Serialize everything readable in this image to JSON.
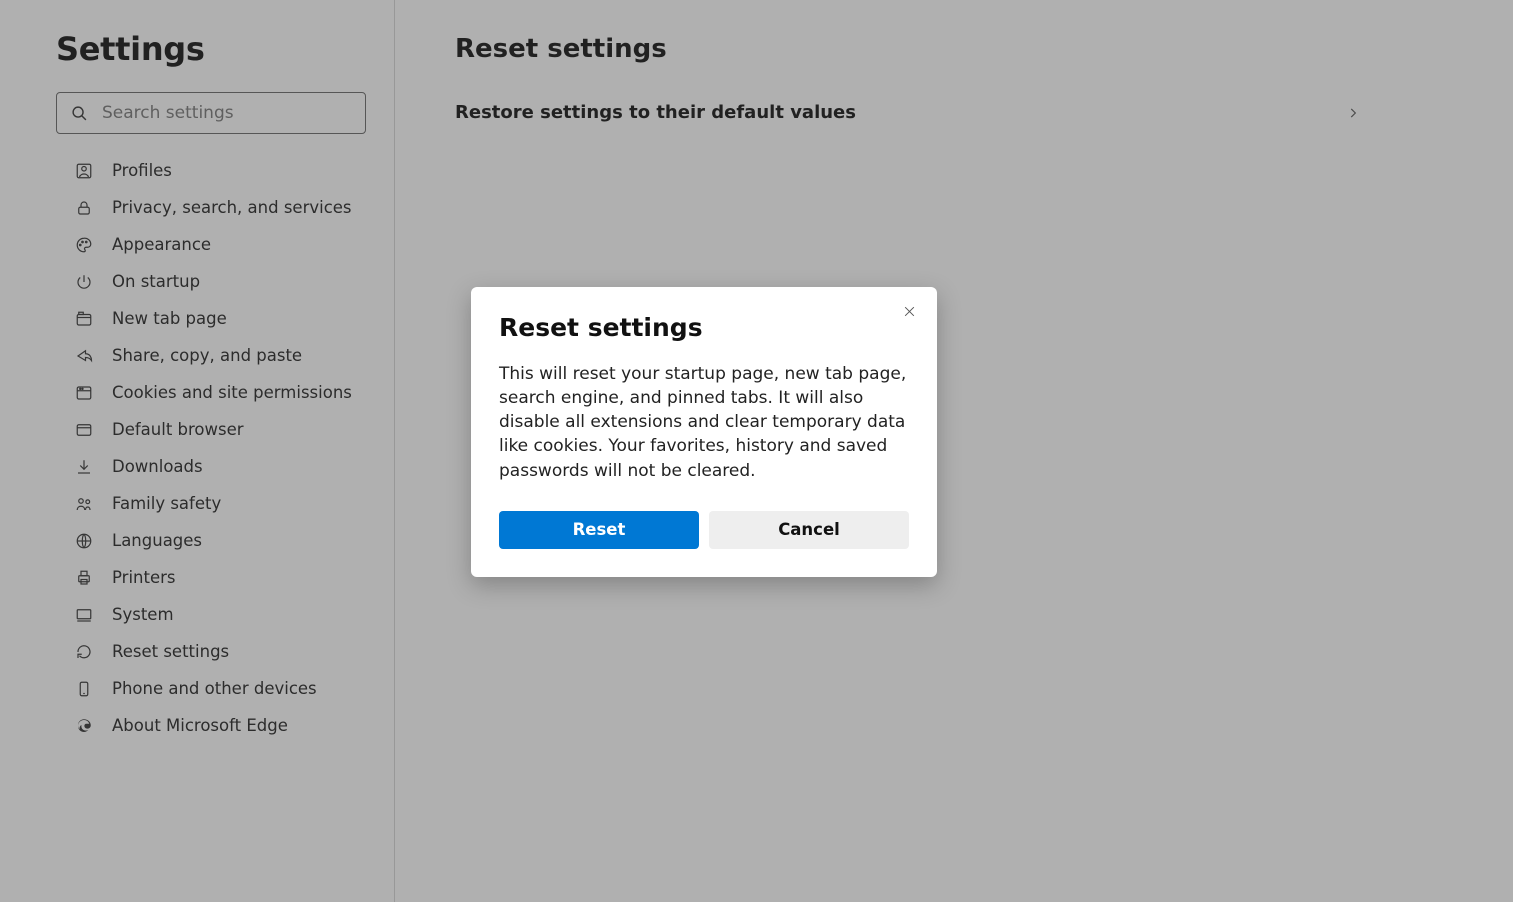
{
  "sidebar": {
    "title": "Settings",
    "search_placeholder": "Search settings",
    "items": [
      {
        "label": "Profiles"
      },
      {
        "label": "Privacy, search, and services"
      },
      {
        "label": "Appearance"
      },
      {
        "label": "On startup"
      },
      {
        "label": "New tab page"
      },
      {
        "label": "Share, copy, and paste"
      },
      {
        "label": "Cookies and site permissions"
      },
      {
        "label": "Default browser"
      },
      {
        "label": "Downloads"
      },
      {
        "label": "Family safety"
      },
      {
        "label": "Languages"
      },
      {
        "label": "Printers"
      },
      {
        "label": "System"
      },
      {
        "label": "Reset settings"
      },
      {
        "label": "Phone and other devices"
      },
      {
        "label": "About Microsoft Edge"
      }
    ]
  },
  "main": {
    "title": "Reset settings",
    "row_label": "Restore settings to their default values"
  },
  "dialog": {
    "title": "Reset settings",
    "body": "This will reset your startup page, new tab page, search engine, and pinned tabs. It will also disable all extensions and clear temporary data like cookies. Your favorites, history and saved passwords will not be cleared.",
    "reset_label": "Reset",
    "cancel_label": "Cancel"
  }
}
